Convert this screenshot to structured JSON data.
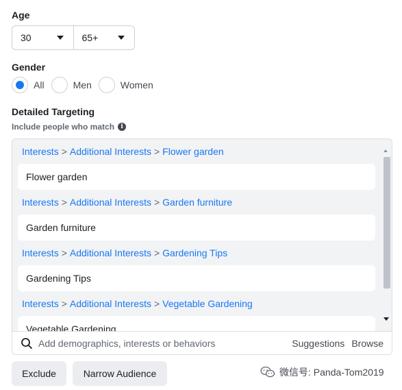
{
  "age": {
    "label": "Age",
    "min_value": "30",
    "max_value": "65+"
  },
  "gender": {
    "label": "Gender",
    "options": [
      {
        "label": "All",
        "selected": true
      },
      {
        "label": "Men",
        "selected": false
      },
      {
        "label": "Women",
        "selected": false
      }
    ]
  },
  "targeting": {
    "label": "Detailed Targeting",
    "sub_label": "Include people who match",
    "info_icon": "info-icon",
    "entries": [
      {
        "path": [
          "Interests",
          "Additional Interests",
          "Flower garden"
        ],
        "item": "Flower garden"
      },
      {
        "path": [
          "Interests",
          "Additional Interests",
          "Garden furniture"
        ],
        "item": "Garden furniture"
      },
      {
        "path": [
          "Interests",
          "Additional Interests",
          "Gardening Tips"
        ],
        "item": "Gardening Tips"
      },
      {
        "path": [
          "Interests",
          "Additional Interests",
          "Vegetable Gardening"
        ],
        "item": "Vegetable Gardening"
      }
    ],
    "path_separator": ">",
    "search_placeholder": "Add demographics, interests or behaviors",
    "suggestions_label": "Suggestions",
    "browse_label": "Browse"
  },
  "actions": {
    "exclude_label": "Exclude",
    "narrow_label": "Narrow Audience"
  },
  "watermark": {
    "text": "微信号: Panda-Tom2019"
  },
  "colors": {
    "accent": "#1877f2",
    "button_bg": "#ebedf0",
    "box_bg": "#f2f3f5"
  }
}
